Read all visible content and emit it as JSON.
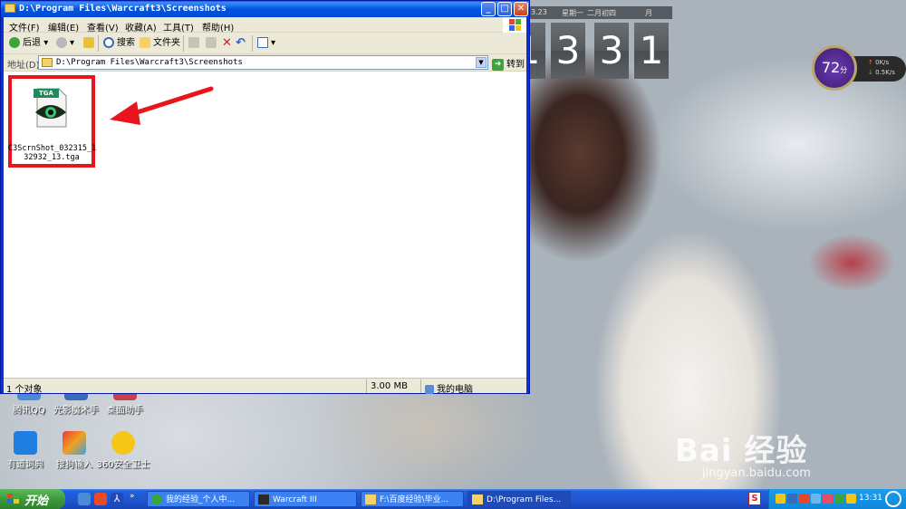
{
  "window": {
    "title": "D:\\Program Files\\Warcraft3\\Screenshots",
    "minimize": "_",
    "maximize": "□",
    "close": "✕"
  },
  "menu": [
    "文件(F)",
    "编辑(E)",
    "查看(V)",
    "收藏(A)",
    "工具(T)",
    "帮助(H)"
  ],
  "toolbar": {
    "back": "后退",
    "search": "搜索",
    "folders": "文件夹"
  },
  "address": {
    "label": "地址(D)",
    "path": "D:\\Program Files\\Warcraft3\\Screenshots",
    "go": "转到"
  },
  "file": {
    "badge": "TGA",
    "name_line1": "C3ScrnShot_032315_1",
    "name_line2": "32932_13.tga"
  },
  "status": {
    "objects": "1 个对象",
    "size": "3.00 MB",
    "location": "我的电脑"
  },
  "clock": {
    "date": "3.23",
    "weekday": "星期一",
    "lunar": "二月初四",
    "month_label": "月",
    "digits": [
      "1",
      "3",
      "3",
      "1"
    ]
  },
  "gauge": {
    "score": "72",
    "unit": "分",
    "up": "0K/s",
    "down": "0.5K/s"
  },
  "desktop_icons": [
    {
      "label": "腾讯QQ"
    },
    {
      "label": "光影魔术手"
    },
    {
      "label": "桌面助手"
    },
    {
      "label": "有道词典"
    },
    {
      "label": "搜狗输入"
    },
    {
      "label": "360安全卫士"
    }
  ],
  "taskbar": {
    "start": "开始",
    "tasks": [
      "我的经验_个人中...",
      "Warcraft III",
      "F:\\百度经验\\毕业...",
      "D:\\Program Files..."
    ],
    "time": "13:31"
  },
  "watermark": {
    "brand": "Bai 经验",
    "url": "jingyan.baidu.com"
  }
}
